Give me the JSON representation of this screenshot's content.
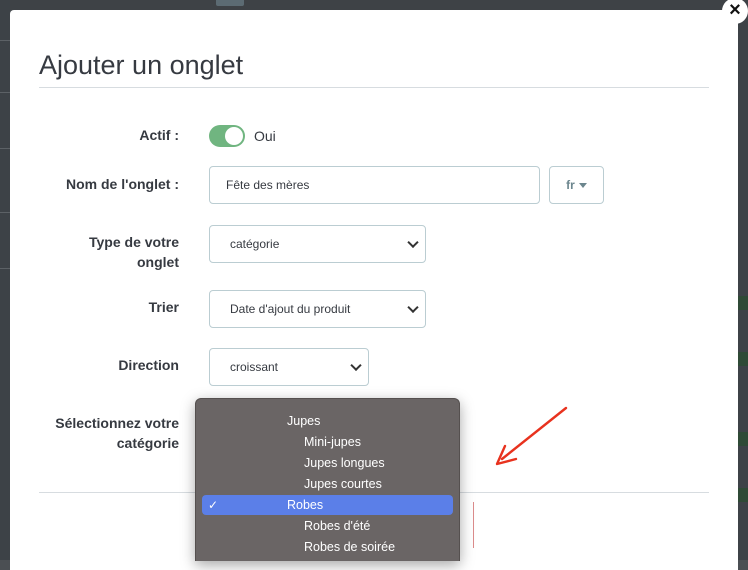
{
  "modal": {
    "title": "Ajouter un onglet",
    "close_glyph": "×"
  },
  "form": {
    "active": {
      "label": "Actif :",
      "value_label": "Oui",
      "checked": true
    },
    "tab_name": {
      "label": "Nom de l'onglet :",
      "value": "Fête des mères",
      "lang": "fr"
    },
    "tab_type": {
      "label": "Type de votre onglet",
      "value": "catégorie"
    },
    "sort": {
      "label": "Trier",
      "value": "Date d'ajout du produit"
    },
    "direction": {
      "label": "Direction",
      "value": "croissant"
    },
    "category": {
      "label": "Sélectionnez votre catégorie",
      "options": [
        {
          "label": "Jupes",
          "level": 0,
          "selected": false
        },
        {
          "label": "Mini-jupes",
          "level": 1,
          "selected": false
        },
        {
          "label": "Jupes longues",
          "level": 1,
          "selected": false
        },
        {
          "label": "Jupes courtes",
          "level": 1,
          "selected": false
        },
        {
          "label": "Robes",
          "level": 0,
          "selected": true
        },
        {
          "label": "Robes d'été",
          "level": 1,
          "selected": false
        },
        {
          "label": "Robes de soirée",
          "level": 1,
          "selected": false
        }
      ],
      "check_glyph": "✓"
    }
  },
  "colors": {
    "switch_on": "#70b580",
    "selected_option": "#5b7fe8",
    "dropdown_bg": "#6a6565",
    "arrow": "#e8321e"
  }
}
